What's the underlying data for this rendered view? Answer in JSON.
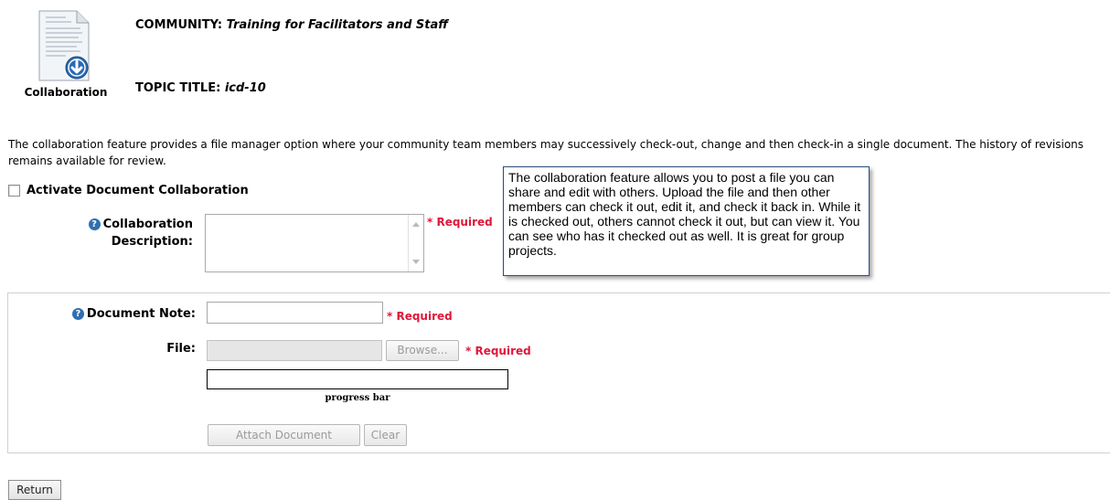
{
  "header": {
    "icon_caption": "Collaboration",
    "community_label": "COMMUNITY:",
    "community_value": "Training for Facilitators and Staff",
    "topic_label": "TOPIC TITLE:",
    "topic_value": "icd-10"
  },
  "intro_text": "The collaboration feature provides a file manager option where your community team members may successively check-out, change and then check-in a single document. The history of revisions remains available for review.",
  "activate": {
    "label": "Activate Document Collaboration",
    "checked": false
  },
  "collab_description": {
    "label_line1": "Collaboration",
    "label_line2": "Description:",
    "value": "",
    "required": "* Required"
  },
  "callout_text": "The collaboration feature allows you to post a file you can share and edit with others.  Upload the file and then other members can check it out, edit it, and check it back in.  While it is checked out, others cannot check it out, but can view it. You can see who has it checked out as well.  It is great for group projects.",
  "document_note": {
    "label": "Document Note:",
    "value": "",
    "required": "* Required"
  },
  "file": {
    "label": "File:",
    "value": "",
    "browse": "Browse...",
    "required": "* Required"
  },
  "progress": {
    "label": "progress bar",
    "value": 0
  },
  "buttons": {
    "attach": "Attach Document",
    "clear": "Clear",
    "return": "Return"
  },
  "icons": {
    "document": "document-download-icon",
    "help": "help-icon"
  },
  "colors": {
    "required": "#e0173a",
    "help_icon": "#2f6fb0"
  }
}
